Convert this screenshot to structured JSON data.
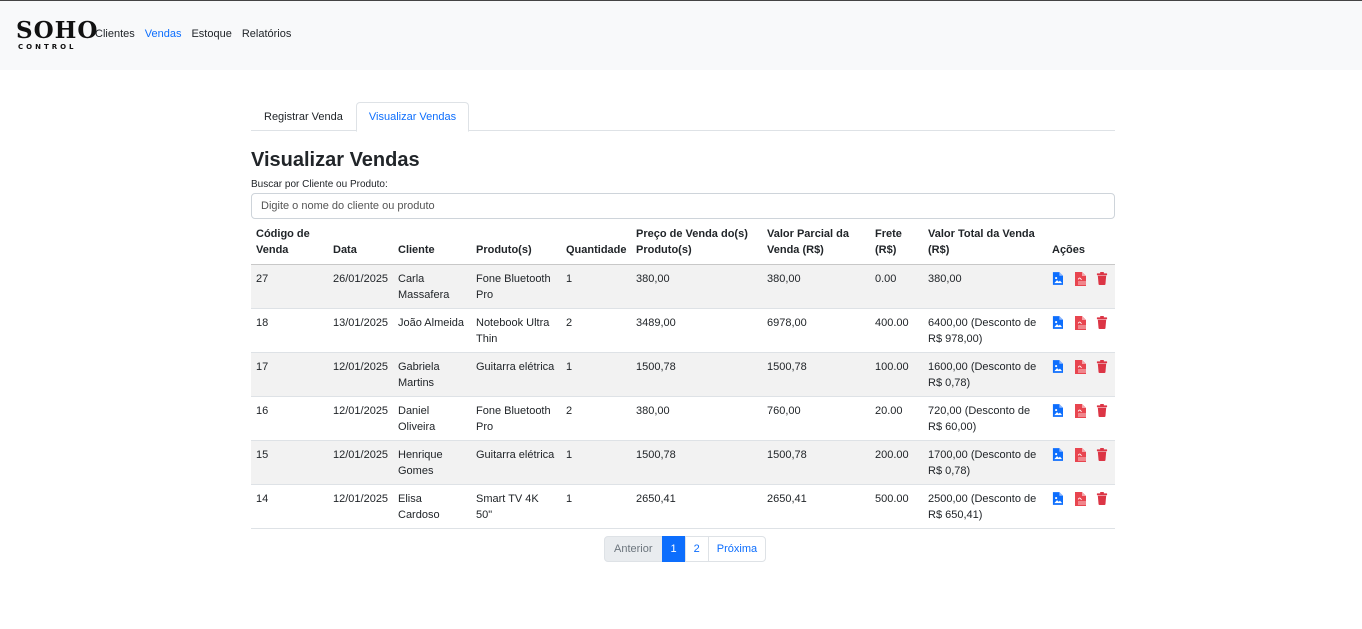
{
  "brand": {
    "logo_main": "SOHO",
    "logo_sub": "CONTROL"
  },
  "nav": {
    "items": [
      {
        "label": "Clientes",
        "active": false
      },
      {
        "label": "Vendas",
        "active": true
      },
      {
        "label": "Estoque",
        "active": false
      },
      {
        "label": "Relatórios",
        "active": false
      }
    ]
  },
  "tabs": [
    {
      "label": "Registrar Venda",
      "active": false
    },
    {
      "label": "Visualizar Vendas",
      "active": true
    }
  ],
  "page_title": "Visualizar Vendas",
  "search": {
    "label": "Buscar por Cliente ou Produto:",
    "placeholder": "Digite o nome do cliente ou produto",
    "value": ""
  },
  "table": {
    "headers": [
      "Código de Venda",
      "Data",
      "Cliente",
      "Produto(s)",
      "Quantidade",
      "Preço de Venda do(s) Produto(s)",
      "Valor Parcial da Venda (R$)",
      "Frete (R$)",
      "Valor Total da Venda (R$)",
      "Ações"
    ],
    "rows": [
      [
        "27",
        "26/01/2025",
        "Carla Massafera",
        "Fone Bluetooth Pro",
        "1",
        "380,00",
        "380,00",
        "0.00",
        "380,00"
      ],
      [
        "18",
        "13/01/2025",
        "João Almeida",
        "Notebook Ultra Thin",
        "2",
        "3489,00",
        "6978,00",
        "400.00",
        "6400,00 (Desconto de R$ 978,00)"
      ],
      [
        "17",
        "12/01/2025",
        "Gabriela Martins",
        "Guitarra elétrica",
        "1",
        "1500,78",
        "1500,78",
        "100.00",
        "1600,00 (Desconto de R$ 0,78)"
      ],
      [
        "16",
        "12/01/2025",
        "Daniel Oliveira",
        "Fone Bluetooth Pro",
        "2",
        "380,00",
        "760,00",
        "20.00",
        "720,00 (Desconto de R$ 60,00)"
      ],
      [
        "15",
        "12/01/2025",
        "Henrique Gomes",
        "Guitarra elétrica",
        "1",
        "1500,78",
        "1500,78",
        "200.00",
        "1700,00 (Desconto de R$ 0,78)"
      ],
      [
        "14",
        "12/01/2025",
        "Elisa Cardoso",
        "Smart TV 4K 50\"",
        "1",
        "2650,41",
        "2650,41",
        "500.00",
        "2500,00 (Desconto de R$ 650,41)"
      ]
    ],
    "action_icons": [
      "image-file-icon",
      "pdf-file-icon",
      "trash-icon"
    ]
  },
  "pagination": {
    "prev_label": "Anterior",
    "pages": [
      "1",
      "2"
    ],
    "current": "1",
    "next_label": "Próxima"
  },
  "colors": {
    "primary": "#0d6efd",
    "danger": "#dc3545",
    "pdf": "#e8454f",
    "navbar_bg": "#f8f9fa",
    "stripe": "#f2f2f2"
  }
}
